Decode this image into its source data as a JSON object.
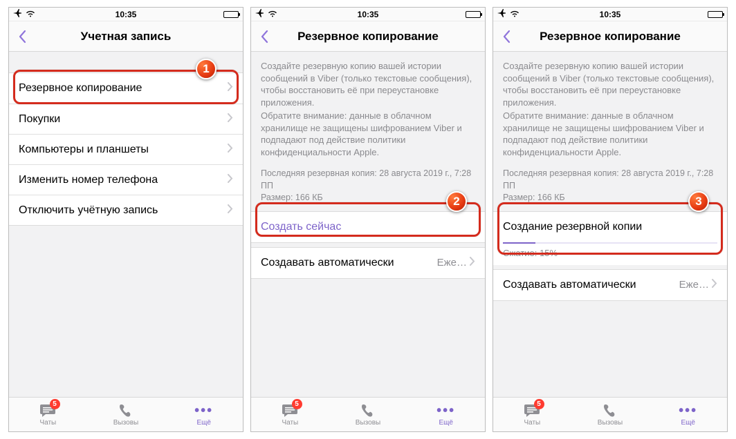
{
  "status": {
    "time": "10:35"
  },
  "screen1": {
    "title": "Учетная запись",
    "rows": [
      {
        "label": "Резервное копирование",
        "disclosure": true
      },
      {
        "label": "Покупки",
        "disclosure": true
      },
      {
        "label": "Компьютеры и планшеты",
        "disclosure": true
      },
      {
        "label": "Изменить номер телефона",
        "disclosure": true
      },
      {
        "label": "Отключить учётную запись",
        "disclosure": true
      }
    ]
  },
  "screen2": {
    "title": "Резервное копирование",
    "desc1": "Создайте резервную копию вашей истории сообщений в Viber (только текстовые сообщения), чтобы восстановить её при переустановке приложения.",
    "desc2": "Обратите внимание: данные в облачном хранилище не защищены шифрованием Viber и подпадают под действие политики конфиденциальности Apple.",
    "meta1": "Последняя резервная копия: 28 августа 2019 г., 7:28 ПП",
    "meta2": "Размер: 166 КБ",
    "create_now": "Создать сейчас",
    "auto_label": "Создавать автоматически",
    "auto_value": "Еже…"
  },
  "screen3": {
    "title": "Резервное копирование",
    "creating_label": "Создание резервной копии",
    "progress_label": "Сжатие: 15%",
    "progress_percent": 15,
    "auto_label": "Создавать автоматически",
    "auto_value": "Еже…"
  },
  "tabs": {
    "chats": "Чаты",
    "calls": "Вызовы",
    "more": "Ещё",
    "badge": "5"
  },
  "callouts": {
    "1": "1",
    "2": "2",
    "3": "3"
  }
}
